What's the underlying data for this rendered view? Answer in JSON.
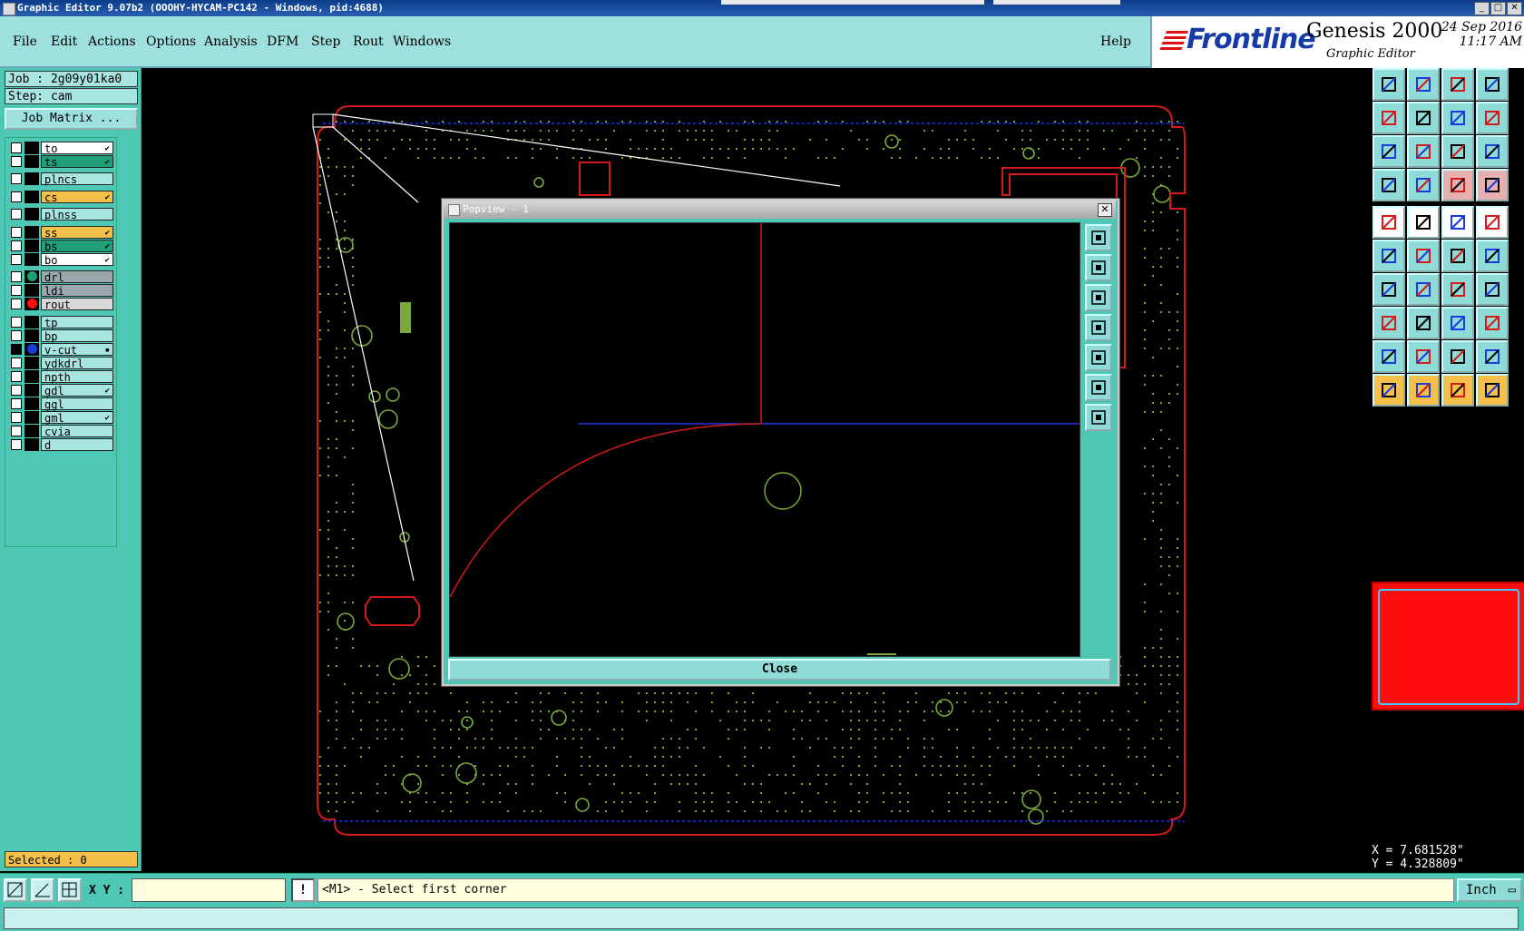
{
  "window": {
    "title": "Graphic Editor 9.07b2 (OOOHY-HYCAM-PC142 - Windows, pid:4688)",
    "controls": [
      "_",
      "□",
      "✕"
    ]
  },
  "menu": {
    "items": [
      "File",
      "Edit",
      "Actions",
      "Options",
      "Analysis",
      "DFM",
      "Step",
      "Rout",
      "Windows"
    ],
    "help": "Help"
  },
  "brand": {
    "logo": "Frontline",
    "product": "Genesis 2000",
    "subtitle": "Graphic Editor",
    "date": "24 Sep 2016",
    "time": "11:17 AM"
  },
  "job": {
    "job_label": "Job : 2g09y01ka0",
    "step_label": "Step: cam",
    "matrix_button": "Job Matrix ..."
  },
  "layers": [
    {
      "name": "to",
      "bg": "#ffffff",
      "flag": "✔"
    },
    {
      "name": "ts",
      "bg": "#1f9e77",
      "flag": "✔"
    },
    {
      "name": "plncs",
      "bg": "#a8e4e0",
      "flag": ""
    },
    {
      "name": "cs",
      "bg": "#f5c04a",
      "flag": "✔"
    },
    {
      "name": "plnss",
      "bg": "#a8e4e0",
      "flag": ""
    },
    {
      "name": "ss",
      "bg": "#f5c04a",
      "flag": "✔"
    },
    {
      "name": "bs",
      "bg": "#1f9e77",
      "flag": "✔"
    },
    {
      "name": "bo",
      "bg": "#ffffff",
      "flag": "✔"
    },
    {
      "name": "drl",
      "bg": "#9aa7ad",
      "flag": ""
    },
    {
      "name": "ldi",
      "bg": "#9aa7ad",
      "flag": ""
    },
    {
      "name": "rout",
      "bg": "#d8d8d8",
      "flag": ""
    },
    {
      "name": "tp",
      "bg": "#a8e4e0",
      "flag": ""
    },
    {
      "name": "bp",
      "bg": "#a8e4e0",
      "flag": ""
    },
    {
      "name": "v-cut",
      "bg": "#a8e4e0",
      "flag": "▪"
    },
    {
      "name": "ydkdrl",
      "bg": "#a8e4e0",
      "flag": ""
    },
    {
      "name": "npth",
      "bg": "#a8e4e0",
      "flag": ""
    },
    {
      "name": "gdl",
      "bg": "#a8e4e0",
      "flag": "✔"
    },
    {
      "name": "ggl",
      "bg": "#a8e4e0",
      "flag": ""
    },
    {
      "name": "gml",
      "bg": "#a8e4e0",
      "flag": "✔"
    },
    {
      "name": "cvia",
      "bg": "#a8e4e0",
      "flag": ""
    },
    {
      "name": "d",
      "bg": "#a8e4e0",
      "flag": ""
    }
  ],
  "selected": "Selected : 0",
  "popview": {
    "title": "Popview - 1",
    "close_x": "✕",
    "close_button": "Close"
  },
  "coords": {
    "x": "X = 7.681528\"",
    "y": "Y = 4.328809\""
  },
  "command": {
    "xy_label": "X Y :",
    "xy_value": "",
    "warn": "!",
    "prompt": "<M1> - Select first corner",
    "unit": "Inch"
  },
  "colors": {
    "panel": "#4ec8b4",
    "menu": "#9ee0de",
    "profile": "#d41a1a",
    "pads": "#7aa83a",
    "vcut": "#2233dd"
  }
}
